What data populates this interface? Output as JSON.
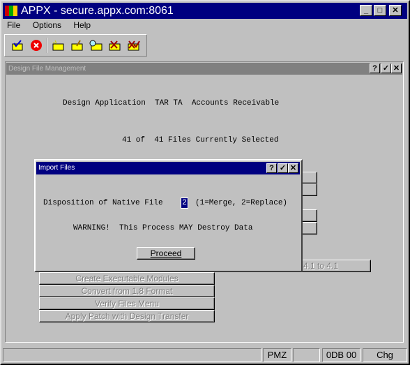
{
  "app": {
    "title": "APPX - secure.appx.com:8061",
    "window_buttons": [
      "_",
      "□",
      "✕"
    ]
  },
  "menu": [
    "File",
    "Options",
    "Help"
  ],
  "toolbar": {
    "icons": [
      "ok-check-icon",
      "cancel-icon",
      "add-record-icon",
      "edit-record-icon",
      "inquire-record-icon",
      "delete-record-icon",
      "delete-confirm-icon"
    ]
  },
  "mdi": {
    "title": "Design File Management",
    "buttons": [
      "?",
      "✓",
      "✕"
    ],
    "line1": "Design Application  TAR TA  Accounts Receivable",
    "line2": "41 of  41 Files Currently Selected",
    "partial_button": "e 4.1 to 4.1",
    "menu_buttons": [
      "Create Executable Modules",
      "Convert from 1.8 Format",
      "Verify Files Menu",
      "Apply Patch with Design Transfer"
    ]
  },
  "dialog": {
    "title": "Import Files",
    "buttons": [
      "?",
      "✓",
      "✕"
    ],
    "label": "Disposition of Native File",
    "value": "2",
    "hint": "(1=Merge, 2=Replace)",
    "warning": "WARNING!  This Process MAY Destroy Data",
    "proceed": "Proceed"
  },
  "status": {
    "cells": [
      "",
      "PMZ",
      "",
      "0DB 00",
      "Chg"
    ]
  }
}
